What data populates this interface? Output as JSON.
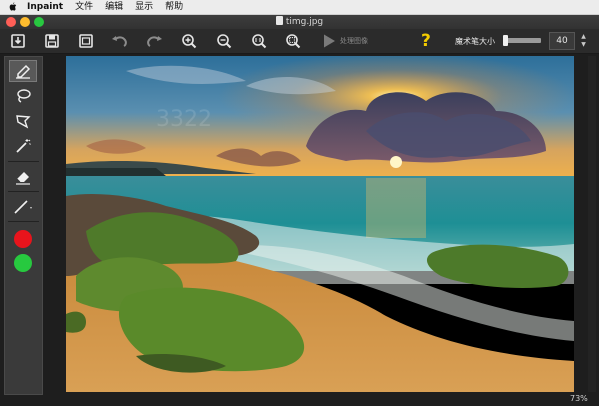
{
  "menubar": {
    "app_name": "Inpaint",
    "items": [
      {
        "label": "文件"
      },
      {
        "label": "编辑"
      },
      {
        "label": "显示"
      },
      {
        "label": "帮助"
      }
    ]
  },
  "window": {
    "title": "timg.jpg"
  },
  "toolbar": {
    "process_label": "处理图像",
    "help_symbol": "?",
    "brush_size_label": "魔术笔大小",
    "brush_size_value": "40",
    "stepper_up": "▲",
    "stepper_down": "▼"
  },
  "colors": {
    "red_marker": "#e8141c",
    "green_marker": "#27c93f",
    "help_accent": "#f4cc00"
  },
  "statusbar": {
    "zoom": "73%"
  },
  "canvas": {
    "watermark": "3322"
  }
}
